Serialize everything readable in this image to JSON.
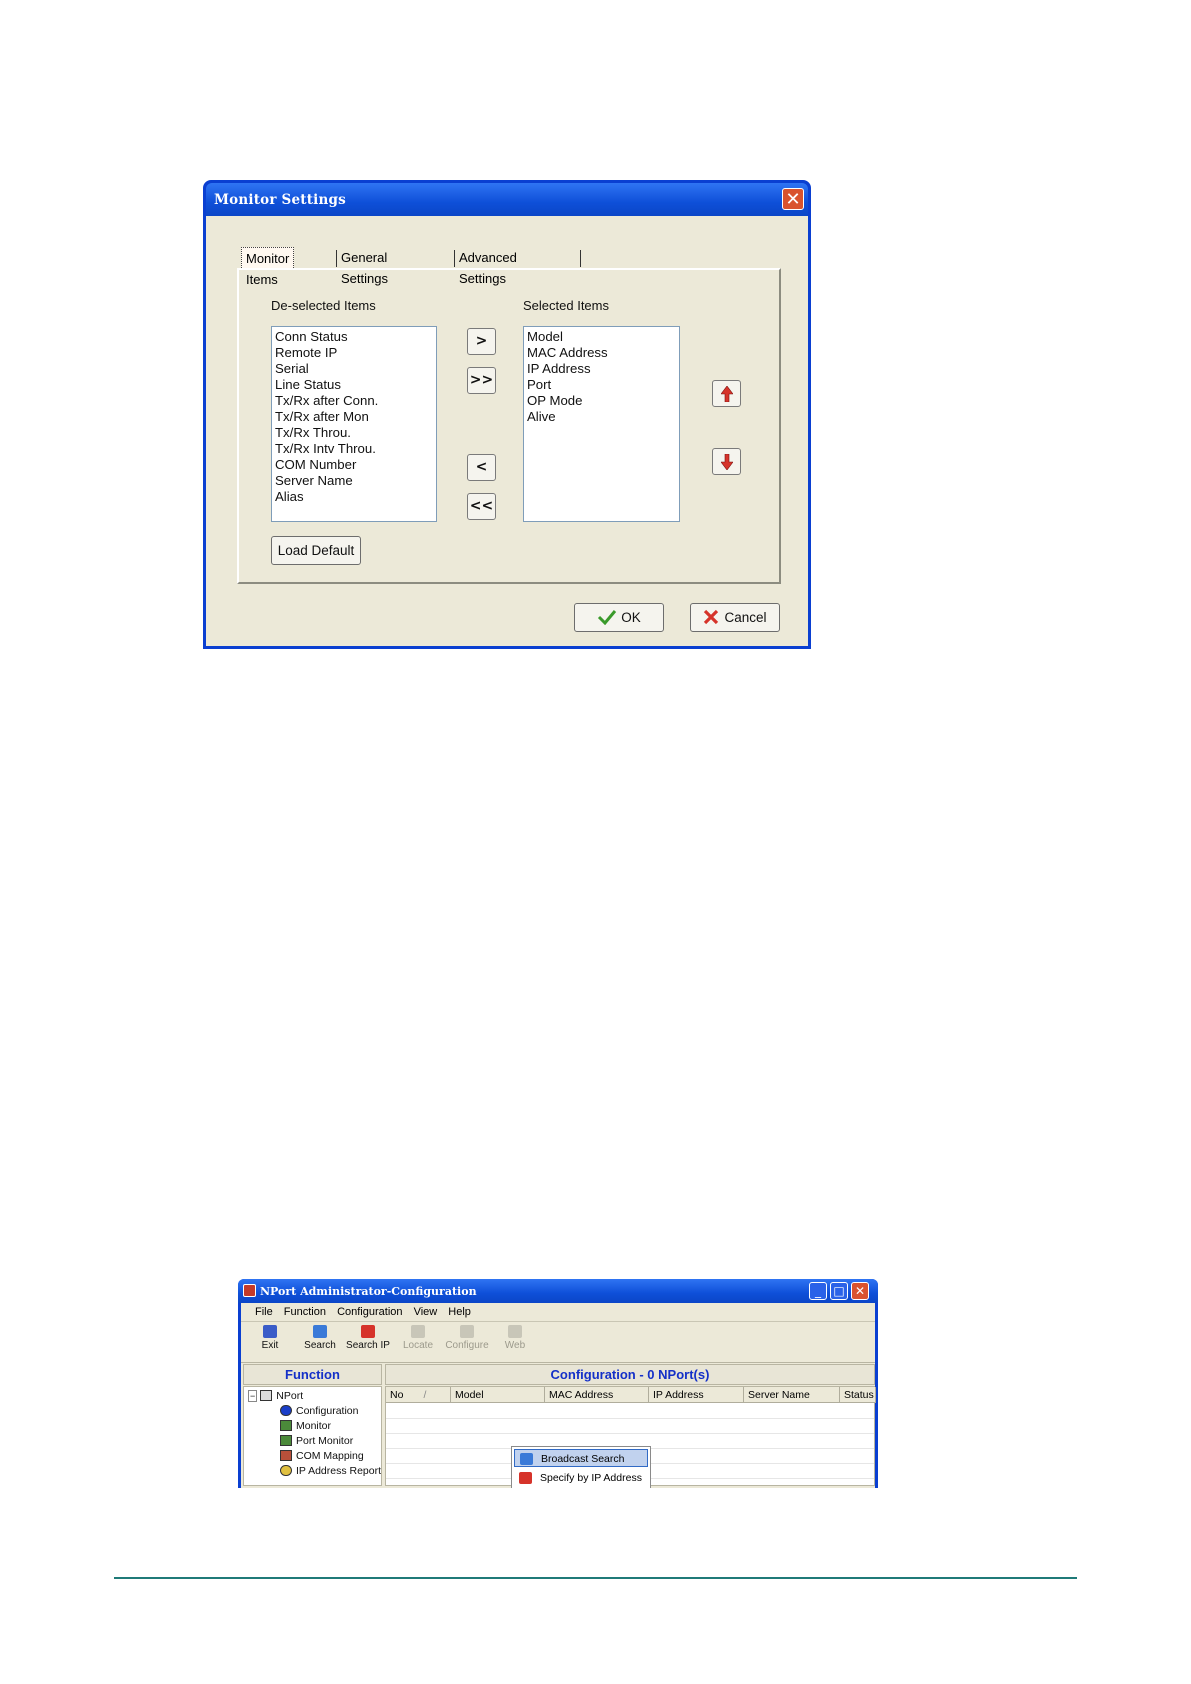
{
  "monitor_dialog": {
    "title": "Monitor Settings",
    "close_label": "✕",
    "tabs": [
      {
        "label": "Monitor Items",
        "active": true
      },
      {
        "label": "General Settings",
        "active": false
      },
      {
        "label": "Advanced Settings",
        "active": false
      }
    ],
    "deselected_label": "De-selected Items",
    "selected_label": "Selected Items",
    "deselected_items": [
      "Conn Status",
      "Remote IP",
      "Serial",
      "Line Status",
      "Tx/Rx after Conn.",
      "Tx/Rx after Mon",
      "Tx/Rx Throu.",
      "Tx/Rx Intv Throu.",
      "COM Number",
      "Server Name",
      "Alias"
    ],
    "selected_items": [
      "Model",
      "MAC Address",
      "IP Address",
      "Port",
      "OP Mode",
      "Alive"
    ],
    "move_right_label": ">",
    "move_all_right_label": ">>",
    "move_left_label": "<",
    "move_all_left_label": "<<",
    "load_default_label": "Load Default",
    "ok_label": "OK",
    "cancel_label": "Cancel",
    "icons": {
      "up": "arrow-up-icon",
      "down": "arrow-down-icon",
      "ok": "checkmark-icon",
      "cancel": "x-icon"
    },
    "colors": {
      "titlebar": "#0e4fd8",
      "body": "#ece9d8",
      "arrow": "#d6332a",
      "check": "#3a9a2a"
    }
  },
  "nport_window": {
    "title": "NPort Administrator-Configuration",
    "window_buttons": [
      "_",
      "□",
      "✕"
    ],
    "menu": [
      "File",
      "Function",
      "Configuration",
      "View",
      "Help"
    ],
    "toolbar": [
      {
        "label": "Exit",
        "enabled": true
      },
      {
        "label": "Search",
        "enabled": true
      },
      {
        "label": "Search IP",
        "enabled": true
      },
      {
        "label": "Locate",
        "enabled": false
      },
      {
        "label": "Configure",
        "enabled": false
      },
      {
        "label": "Web",
        "enabled": false
      }
    ],
    "function_header": "Function",
    "config_header": "Configuration - 0 NPort(s)",
    "tree_root": "NPort",
    "tree_items": [
      "Configuration",
      "Monitor",
      "Port Monitor",
      "COM Mapping",
      "IP Address Report"
    ],
    "columns": [
      "No",
      "Model",
      "MAC Address",
      "IP Address",
      "Server Name",
      "Status"
    ],
    "sort_indicator": "/",
    "context_menu": [
      "Broadcast Search",
      "Specify by IP Address"
    ],
    "colors": {
      "header_text": "#1430c8",
      "highlight": "#c1d2ee"
    }
  }
}
